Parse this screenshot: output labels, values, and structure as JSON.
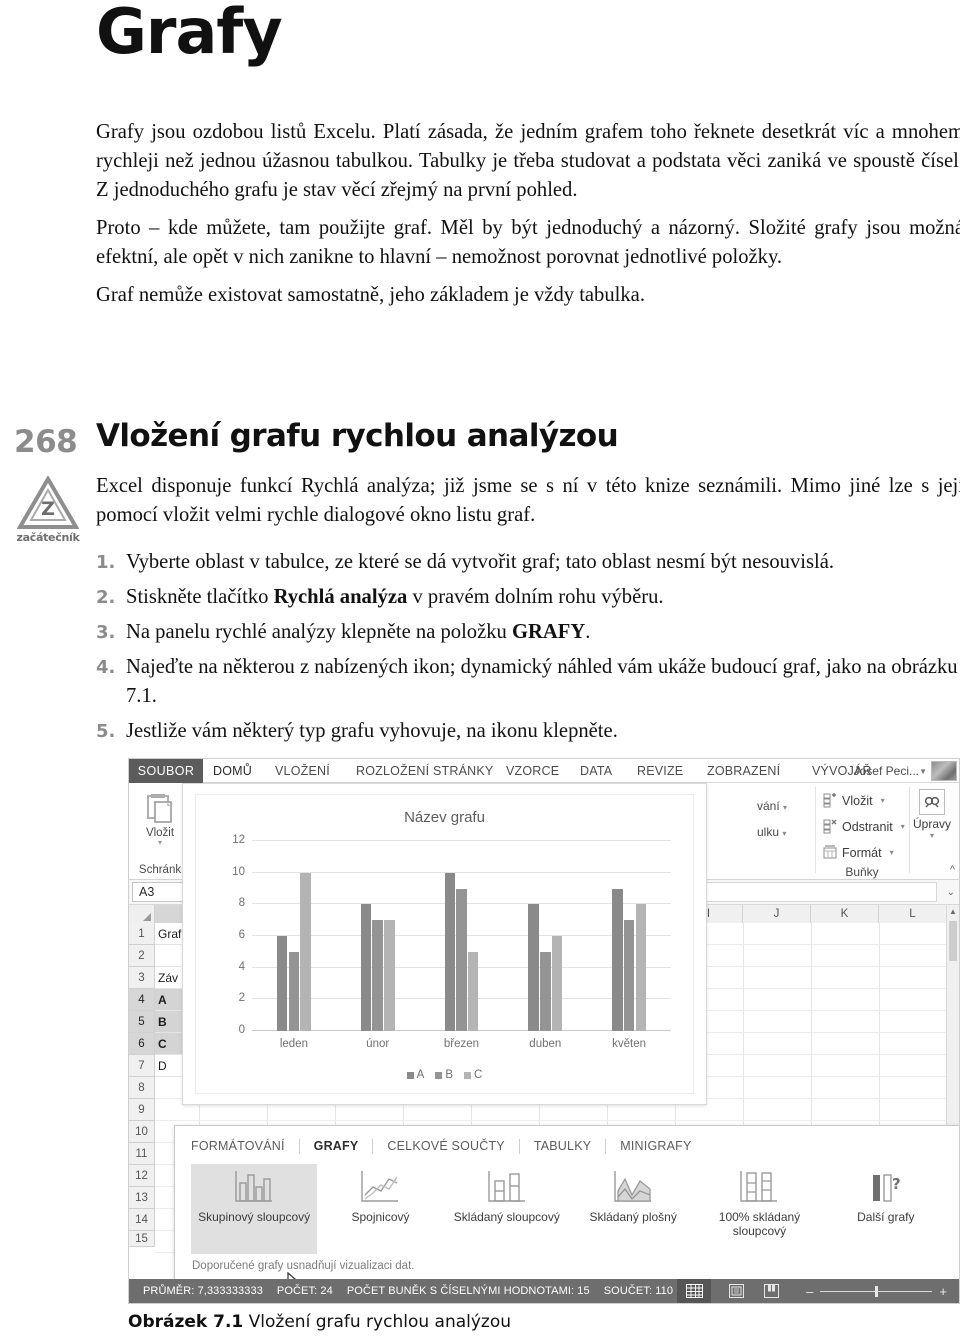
{
  "chapter": {
    "title": "Grafy"
  },
  "paragraphs": [
    "Grafy jsou ozdobou listů Excelu. Platí zásada, že jedním grafem toho řeknete desetkrát víc a mnohem rychleji než jednou úžasnou tabulkou. Tabulky je třeba studovat a podstata věci zaniká ve spoustě čísel. Z jednoduchého grafu je stav věcí zřejmý na první pohled.",
    "Proto – kde můžete, tam použijte graf. Měl by být jednoduchý a názorný. Složité grafy jsou možná efektní, ale opět v nich zanikne to hlavní – nemožnost porovnat jednotlivé položky.",
    "Graf nemůže existovat samostatně, jeho základem je vždy tabulka."
  ],
  "section": {
    "page_number": "268",
    "heading": "Vložení grafu rychlou analýzou",
    "margin_icon_label": "začátečník",
    "margin_icon_letter": "Z",
    "intro": "Excel disponuje funkcí Rychlá analýza; již jsme se s ní v této knize seznámili. Mimo jiné lze s její pomocí vložit velmi rychle dialogové okno listu graf."
  },
  "steps": [
    {
      "num": "1.",
      "text_before": "Vyberte oblast v tabulce, ze které se dá vytvořit graf; tato oblast nesmí být nesouvislá.",
      "bold": "",
      "text_after": ""
    },
    {
      "num": "2.",
      "text_before": "Stiskněte tlačítko ",
      "bold": "Rychlá analýza",
      "text_after": " v pravém dolním rohu výběru."
    },
    {
      "num": "3.",
      "text_before": "Na panelu rychlé analýzy klepněte na položku ",
      "bold": "GRAFY",
      "text_after": "."
    },
    {
      "num": "4.",
      "text_before": "Najeďte na některou z nabízených ikon; dynamický náhled vám ukáže budoucí graf, jako na obrázku 7.1.",
      "bold": "",
      "text_after": ""
    },
    {
      "num": "5.",
      "text_before": "Jestliže vám některý typ grafu vyhovuje, na ikonu klepněte.",
      "bold": "",
      "text_after": ""
    }
  ],
  "figure": {
    "caption_label": "Obrázek 7.1",
    "caption_text": " Vložení grafu rychlou analýzou"
  },
  "excel": {
    "file_tab": "SOUBOR",
    "tabs": [
      "DOMŮ",
      "VLOŽENÍ",
      "ROZLOŽENÍ STRÁNKY",
      "VZORCE",
      "DATA",
      "REVIZE",
      "ZOBRAZENÍ",
      "VÝVOJÁŘ"
    ],
    "active_tab": "DOMŮ",
    "user": "Josef Peci...",
    "clipboard": {
      "label": "Vložit",
      "group": "Schránk"
    },
    "cells_group": {
      "label": "Buňky",
      "commands": [
        "Vložit",
        "Odstranit",
        "Formát"
      ]
    },
    "partial_commands": [
      "vání",
      "ulku"
    ],
    "editing_group": {
      "label": "Úpravy"
    },
    "name_box": "A3",
    "columns": [
      "I",
      "J",
      "K",
      "L"
    ],
    "rows": [
      "1",
      "2",
      "3",
      "4",
      "5",
      "6",
      "7",
      "8",
      "9",
      "10",
      "11",
      "12",
      "13",
      "14",
      "15"
    ],
    "cells": {
      "1": "Graf",
      "3": "Záv",
      "4": "A",
      "5": "B",
      "6": "C",
      "7": "D"
    },
    "selected_rows": [
      "4",
      "5",
      "6"
    ],
    "status": {
      "average": "PRŮMĚR: 7,333333333",
      "count": "POČET: 24",
      "numeric_count": "POČET BUNĚK S ČÍSELNÝMI HODNOTAMI: 15",
      "sum": "SOUČET: 110",
      "zoom_minus": "–",
      "zoom_plus": "+"
    }
  },
  "quick_analysis": {
    "tabs": [
      "FORMÁTOVÁNÍ",
      "GRAFY",
      "CELKOVÉ SOUČTY",
      "TABULKY",
      "MINIGRAFY"
    ],
    "active_tab": "GRAFY",
    "items": [
      {
        "label": "Skupinový sloupcový",
        "icon": "clustered-column-icon",
        "selected": true
      },
      {
        "label": "Spojnicový",
        "icon": "line-chart-icon",
        "selected": false
      },
      {
        "label": "Skládaný sloupcový",
        "icon": "stacked-column-icon",
        "selected": false
      },
      {
        "label": "Skládaný plošný",
        "icon": "stacked-area-icon",
        "selected": false
      },
      {
        "label": "100% skládaný sloupcový",
        "icon": "percent-stacked-column-icon",
        "selected": false
      },
      {
        "label": "Další grafy",
        "icon": "more-charts-icon",
        "selected": false
      }
    ],
    "note": "Doporučené grafy usnadňují vizualizaci dat."
  },
  "chart_data": {
    "type": "bar",
    "title": "Název grafu",
    "categories": [
      "leden",
      "únor",
      "březen",
      "duben",
      "květen"
    ],
    "series": [
      {
        "name": "A",
        "values": [
          6,
          8,
          10,
          8,
          9
        ],
        "color": "#8a8a8a"
      },
      {
        "name": "B",
        "values": [
          5,
          7,
          9,
          5,
          7
        ],
        "color": "#949494"
      },
      {
        "name": "C",
        "values": [
          10,
          7,
          5,
          6,
          8
        ],
        "color": "#b4b4b4"
      }
    ],
    "yticks": [
      0,
      2,
      4,
      6,
      8,
      10,
      12
    ],
    "ylim": [
      0,
      12
    ],
    "xlabel": "",
    "ylabel": "",
    "grid": true,
    "legend_position": "bottom"
  }
}
